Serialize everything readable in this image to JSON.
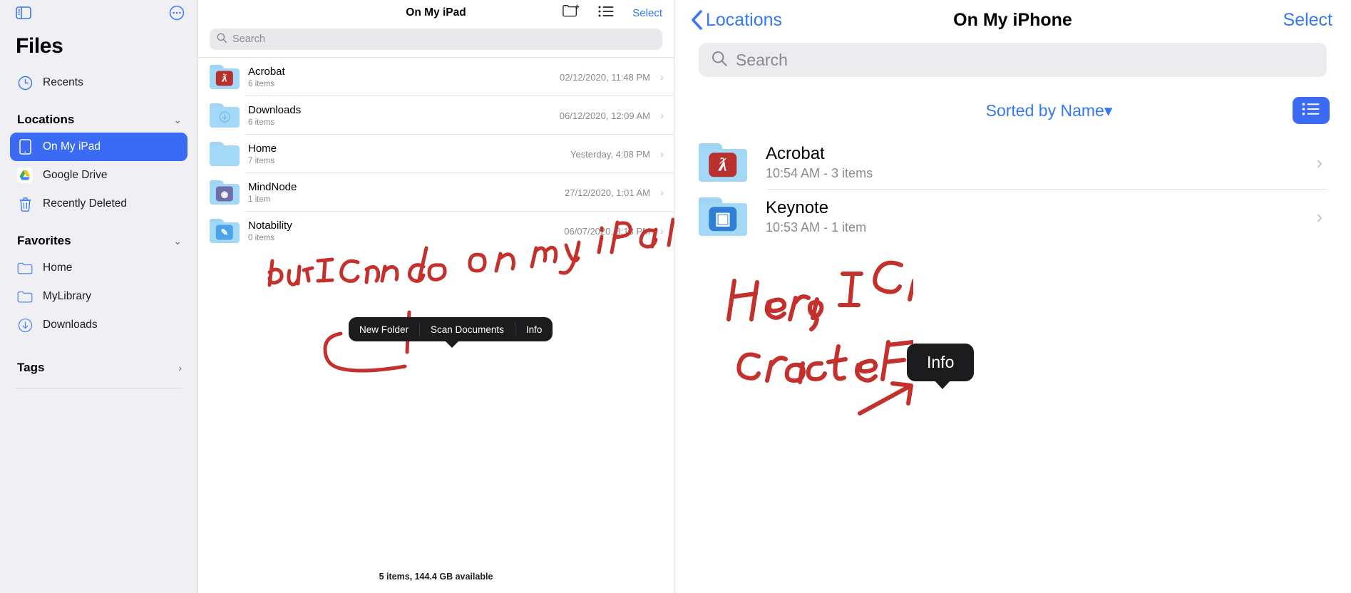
{
  "sidebar": {
    "app_title": "Files",
    "toolbar": {
      "sidebar_toggle_icon": "sidebar-toggle-icon",
      "more_icon": "ellipsis-circle-icon"
    },
    "recents": {
      "label": "Recents",
      "icon": "clock-icon"
    },
    "sections": [
      {
        "title": "Locations",
        "chevron": "⌄",
        "items": [
          {
            "label": "On My iPad",
            "icon": "ipad-icon",
            "selected": true
          },
          {
            "label": "Google Drive",
            "icon": "google-drive-icon",
            "selected": false
          },
          {
            "label": "Recently Deleted",
            "icon": "trash-icon",
            "selected": false
          }
        ]
      },
      {
        "title": "Favorites",
        "chevron": "⌄",
        "items": [
          {
            "label": "Home",
            "icon": "folder-icon",
            "selected": false
          },
          {
            "label": "MyLibrary",
            "icon": "folder-icon",
            "selected": false
          },
          {
            "label": "Downloads",
            "icon": "download-circle-icon",
            "selected": false
          }
        ]
      },
      {
        "title": "Tags",
        "chevron": "›",
        "items": []
      }
    ]
  },
  "middle": {
    "nav_title": "On My iPad",
    "new_folder_icon": "new-folder-icon",
    "list_view_icon": "list-view-icon",
    "select_label": "Select",
    "search_placeholder": "Search",
    "search_icon": "search-icon",
    "files": [
      {
        "name": "Acrobat",
        "sub": "6 items",
        "date": "02/12/2020, 11:48 PM",
        "badge": "pdf",
        "glyph": "ƛ"
      },
      {
        "name": "Downloads",
        "sub": "6 items",
        "date": "06/12/2020, 12:09 AM",
        "badge": "dl",
        "glyph": "↓"
      },
      {
        "name": "Home",
        "sub": "7 items",
        "date": "Yesterday, 4:08 PM",
        "badge": "none",
        "glyph": ""
      },
      {
        "name": "MindNode",
        "sub": "1 item",
        "date": "27/12/2020, 1:01 AM",
        "badge": "mind",
        "glyph": "◉"
      },
      {
        "name": "Notability",
        "sub": "0 items",
        "date": "06/07/2020, 8:13 PM",
        "badge": "nota",
        "glyph": "✎"
      }
    ],
    "status": "5 items, 144.4 GB available",
    "context_menu": {
      "items": [
        "New Folder",
        "Scan Documents",
        "Info"
      ]
    },
    "annotation": "but I Can do on my iPad!"
  },
  "right": {
    "back_label": "Locations",
    "back_icon": "chevron-left-icon",
    "nav_title": "On My iPhone",
    "select_label": "Select",
    "search_placeholder": "Search",
    "search_icon": "search-icon",
    "sort_label": "Sorted by Name",
    "sort_caret": "▾",
    "view_icon": "list-view-icon",
    "files": [
      {
        "name": "Acrobat",
        "sub": "10:54 AM - 3 items",
        "badge": "pdf",
        "glyph": "ƛ"
      },
      {
        "name": "Keynote",
        "sub": "10:53 AM - 1 item",
        "badge": "key",
        "glyph": "▣"
      }
    ],
    "info_popup": "Info",
    "annotation_line1": "Here, I Cannot",
    "annotation_line2": "create Folders"
  },
  "colors": {
    "accent_blue": "#3478f6",
    "selection_blue": "#3b6bf5",
    "ink_red": "#c4302b",
    "popup_black": "#1c1c1e",
    "folder_blue": "#a4d8f7"
  }
}
